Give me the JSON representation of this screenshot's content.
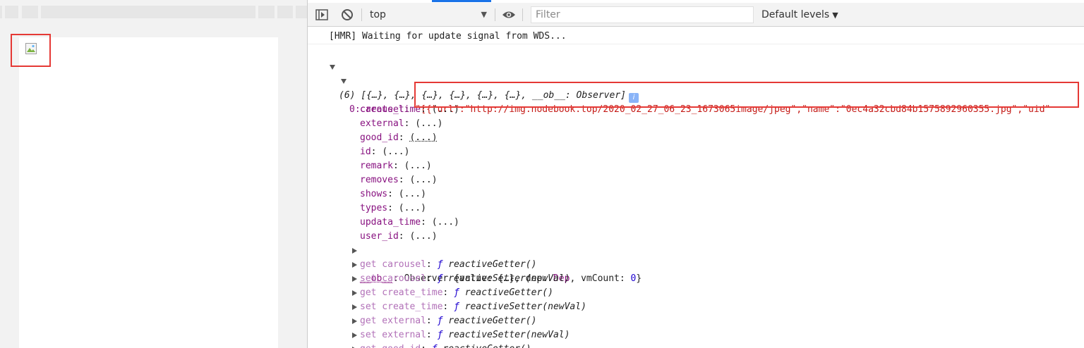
{
  "page": {
    "broken_image_icon": "broken-image-icon"
  },
  "devtools": {
    "toolbar": {
      "sidebar_toggle_icon": "sidebar-toggle-icon",
      "clear_icon": "block-icon",
      "context": "top",
      "live_expression_icon": "eye-icon",
      "filter_placeholder": "Filter",
      "levels": "Default levels"
    },
    "console": {
      "hmr_message": "[HMR] Waiting for update signal from WDS...",
      "array_summary": "(6) [{…}, {…}, {…}, {…}, {…}, {…}, __ob__: Observer]",
      "info_badge": "i",
      "index_key": "0:",
      "carousel": {
        "key": "carousel",
        "value": "\"[{\"url\":\"http://img.nodebook.top/2020_02_27_06_23_1673065image/jpeg\",\"name\":\"0ec4a32cbd84b1575892960355.jpg\",\"uid\""
      },
      "lazy_properties": [
        {
          "key": "create_time",
          "value": "(...)"
        },
        {
          "key": "external",
          "value": "(...)"
        },
        {
          "key": "good_id",
          "value": "(...)"
        },
        {
          "key": "id",
          "value": "(...)"
        },
        {
          "key": "remark",
          "value": "(...)"
        },
        {
          "key": "removes",
          "value": "(...)"
        },
        {
          "key": "shows",
          "value": "(...)"
        },
        {
          "key": "types",
          "value": "(...)"
        },
        {
          "key": "updata_time",
          "value": "(...)"
        },
        {
          "key": "user_id",
          "value": "(...)"
        }
      ],
      "observer": {
        "key": "__ob__",
        "value_prefix": "Observer {value: {…}, dep: ",
        "dep": "Dep",
        "value_mid": ", vmCount: ",
        "vm_count": "0",
        "value_suffix": "}"
      },
      "accessors": [
        {
          "key": "get carousel",
          "fn_symbol": "ƒ",
          "fn": "reactiveGetter()"
        },
        {
          "key": "set carousel",
          "fn_symbol": "ƒ",
          "fn": "reactiveSetter(newVal)"
        },
        {
          "key": "get create_time",
          "fn_symbol": "ƒ",
          "fn": "reactiveGetter()"
        },
        {
          "key": "set create_time",
          "fn_symbol": "ƒ",
          "fn": "reactiveSetter(newVal)"
        },
        {
          "key": "get external",
          "fn_symbol": "ƒ",
          "fn": "reactiveGetter()"
        },
        {
          "key": "set external",
          "fn_symbol": "ƒ",
          "fn": "reactiveSetter(newVal)"
        },
        {
          "key": "get good_id",
          "fn_symbol": "ƒ",
          "fn": "reactiveGetter()"
        }
      ]
    }
  }
}
